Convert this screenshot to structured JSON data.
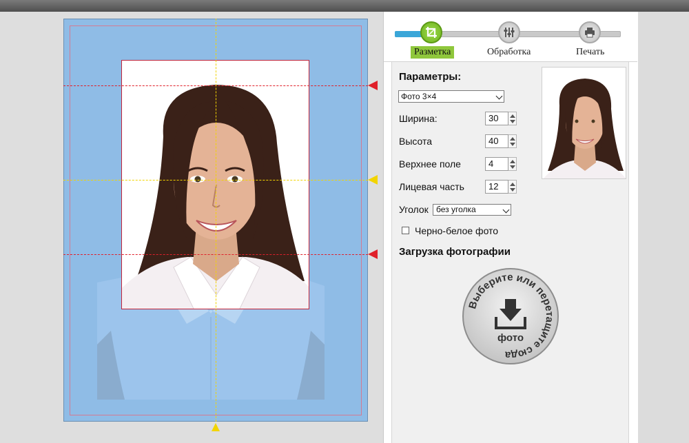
{
  "steps": [
    {
      "label": "Разметка",
      "icon": "crop-icon",
      "active": true
    },
    {
      "label": "Обработка",
      "icon": "sliders-icon",
      "active": false
    },
    {
      "label": "Печать",
      "icon": "printer-icon",
      "active": false
    }
  ],
  "step_progress_percent": 17,
  "params": {
    "title": "Параметры:",
    "format_value": "Фото 3×4",
    "fields": [
      {
        "label": "Ширина:",
        "value": "30"
      },
      {
        "label": "Высота",
        "value": "40"
      },
      {
        "label": "Верхнее поле",
        "value": "4"
      },
      {
        "label": "Лицевая часть",
        "value": "12"
      }
    ],
    "corner_label": "Уголок",
    "corner_value": "без уголка",
    "bw_label": "Черно-белое фото",
    "bw_checked": false
  },
  "upload": {
    "title": "Загрузка фотографии",
    "ring_text": "Выберите или перетащите сюда",
    "center_label": "фото",
    "icon": "download-tray-icon"
  },
  "colors": {
    "sheet": "#8fbce6",
    "crop_border": "#c2243a",
    "guide_red": "#e0202a",
    "guide_yellow": "#f2d400",
    "active_step": "#8fc73c",
    "progress": "#3aa6d8"
  }
}
